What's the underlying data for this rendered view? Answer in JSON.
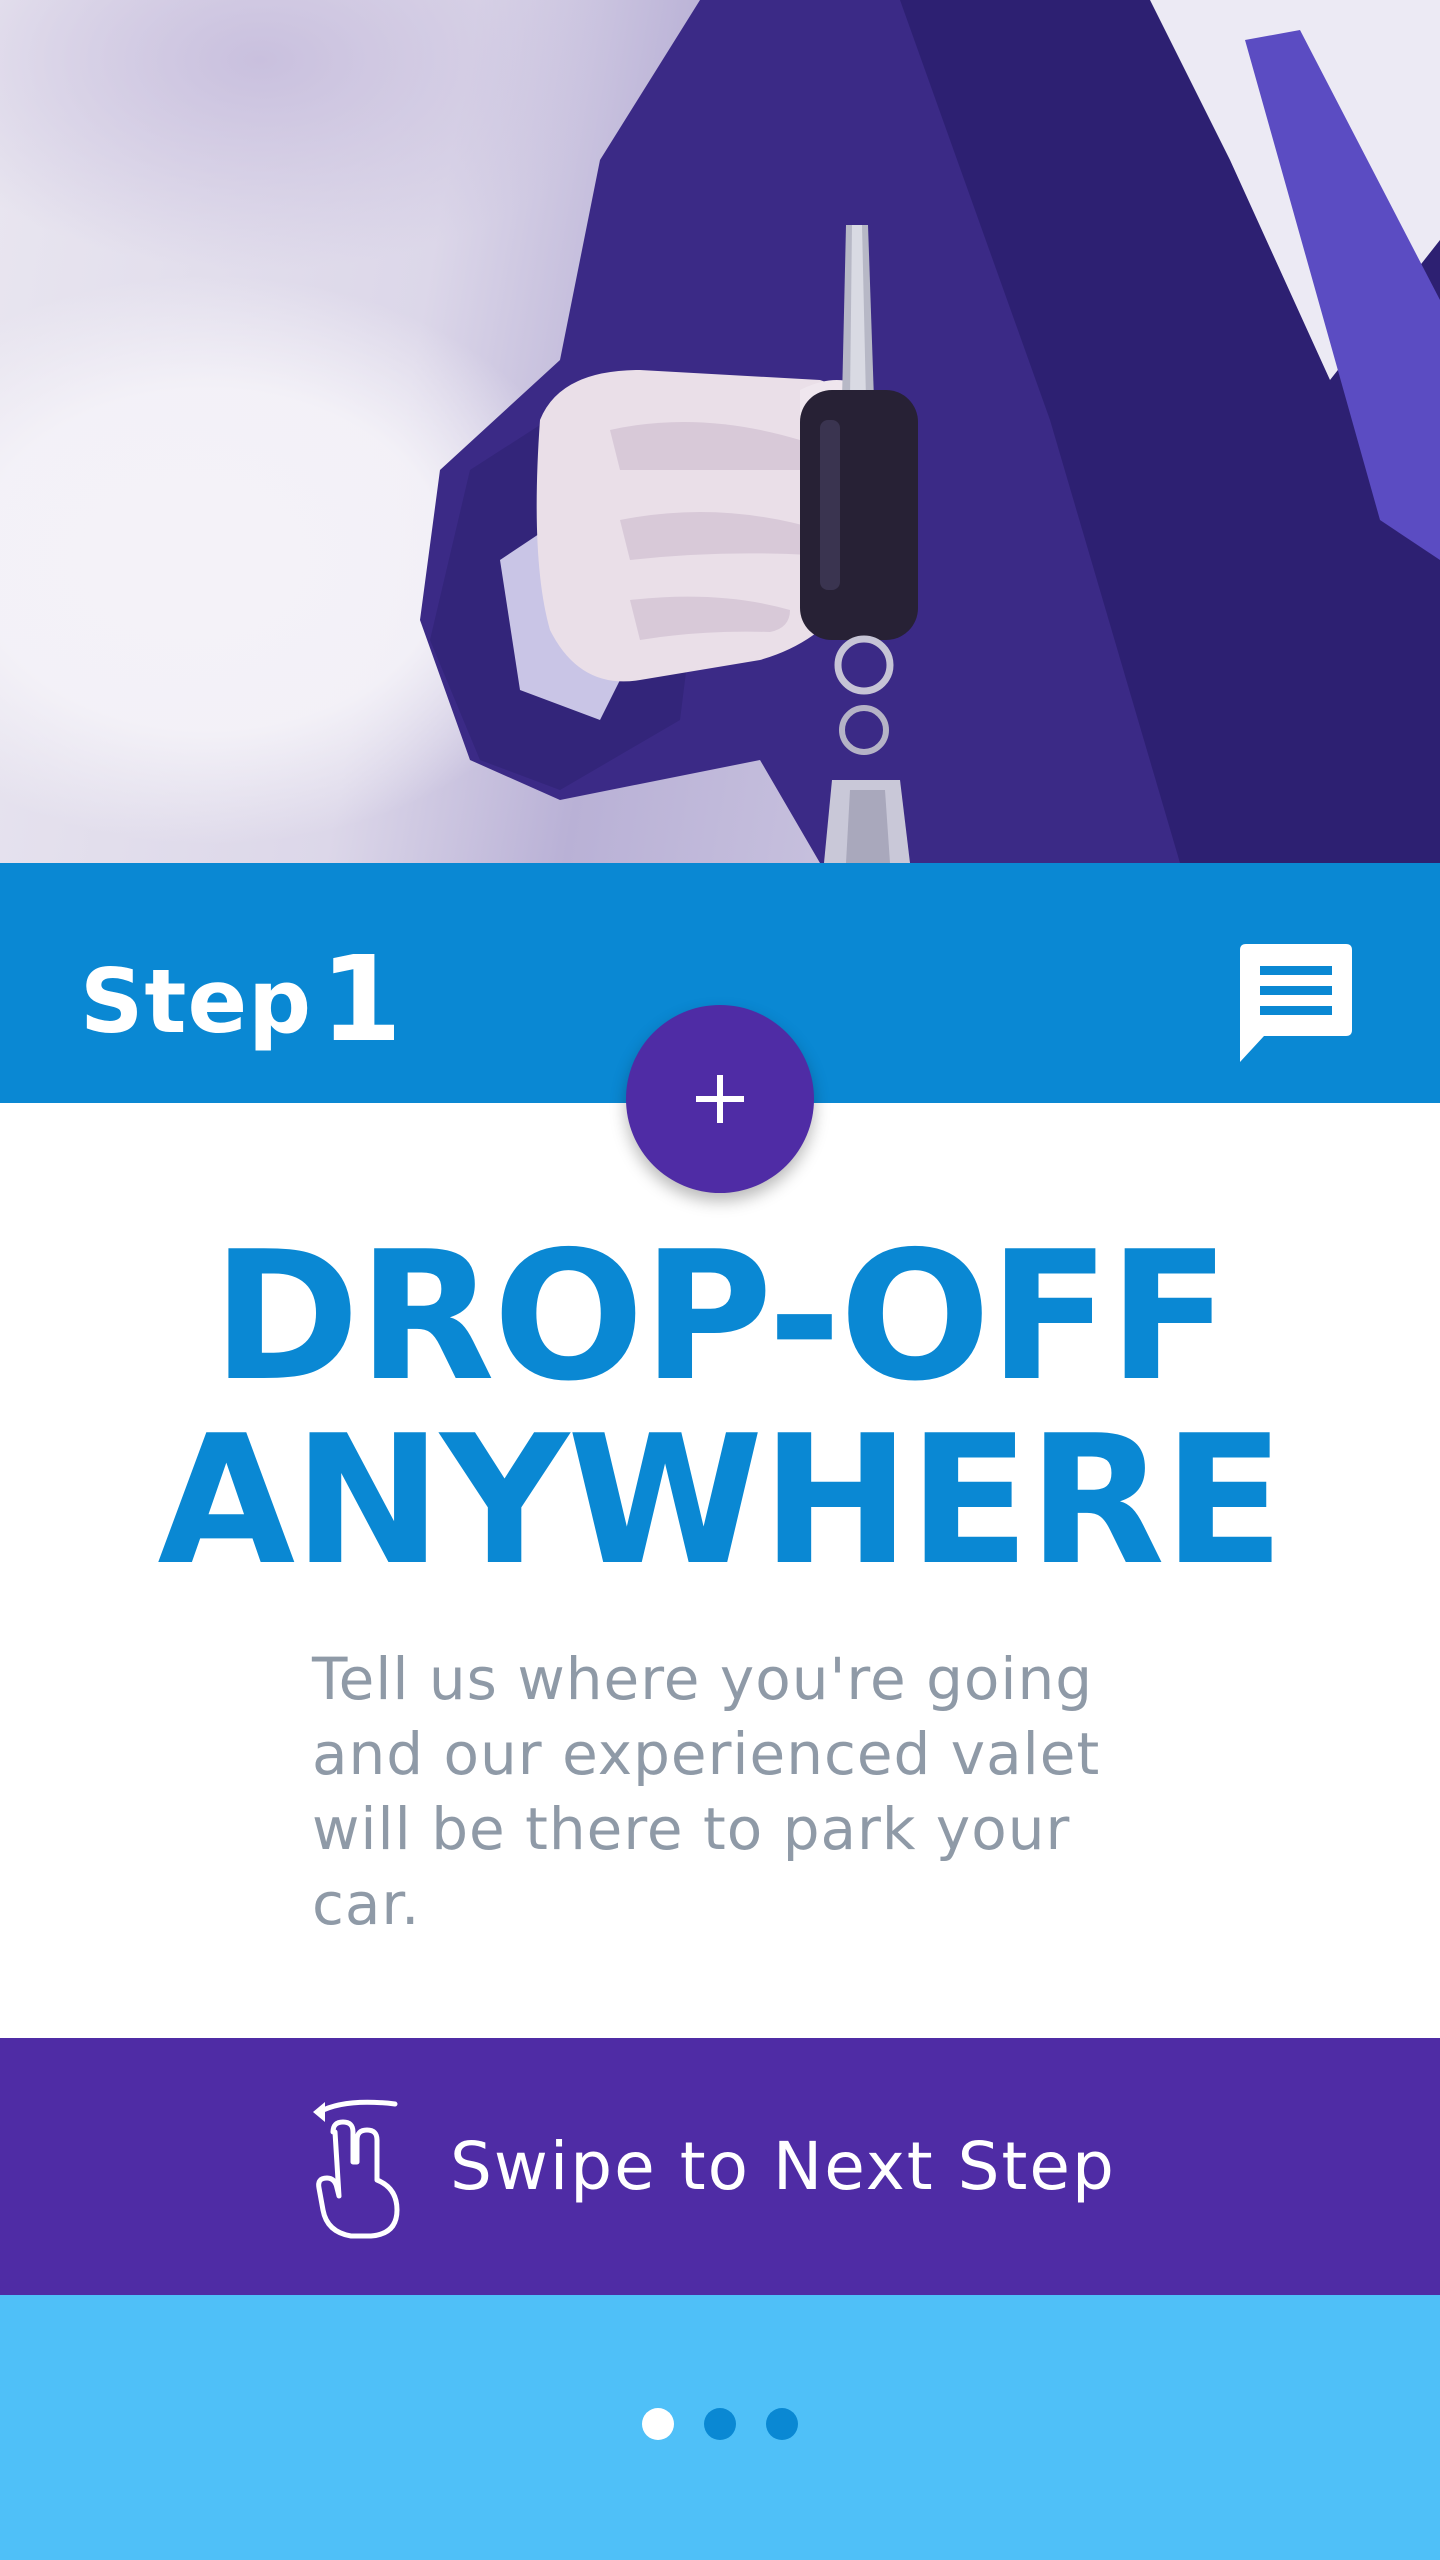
{
  "hero": {
    "image_alt": "hand-holding-car-key-photo"
  },
  "step_bar": {
    "label": "Step",
    "number": "1",
    "chat_icon": "chat-icon",
    "color": "#0a88d3"
  },
  "fab": {
    "icon": "plus-icon",
    "color": "#4f2ca5"
  },
  "headline": {
    "line1": "DROP-OFF",
    "line2": "ANYWHERE",
    "color": "#0a88d3"
  },
  "description": {
    "line1": "Tell us where you're going",
    "line2": "and our experienced valet",
    "line3": "will be there to park your",
    "line4": "car.",
    "color": "#8f9aa7"
  },
  "swipe": {
    "label": "Swipe to Next Step",
    "icon": "swipe-gesture-icon",
    "color": "#4f2ca5"
  },
  "pager": {
    "count": 3,
    "active_index": 0,
    "background": "#4fc0f8",
    "active_color": "#ffffff",
    "inactive_color": "#0a88d3"
  }
}
